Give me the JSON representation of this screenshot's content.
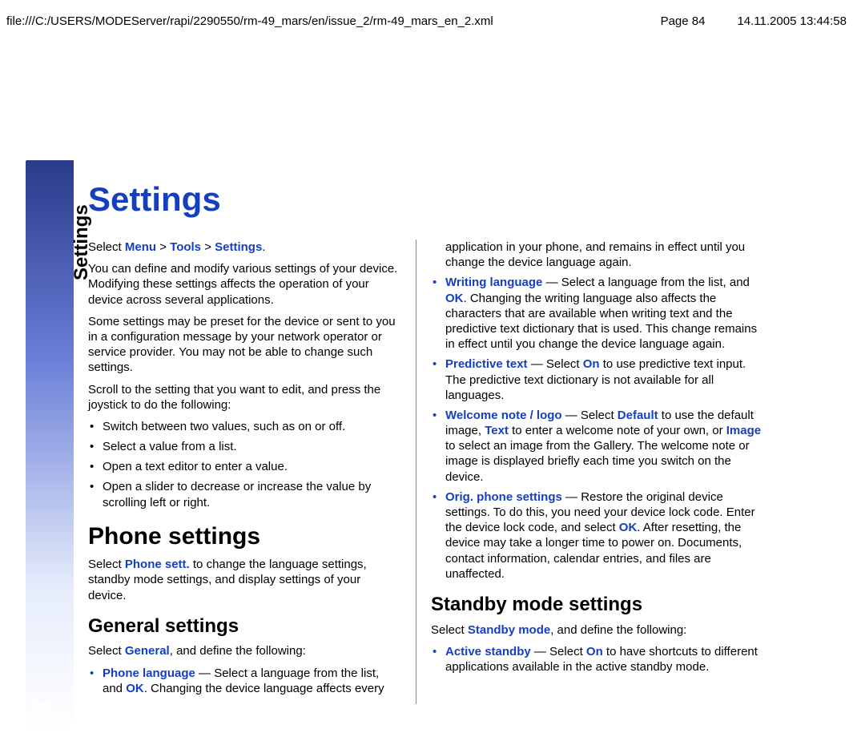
{
  "header": {
    "path": "file:///C:/USERS/MODEServer/rapi/2290550/rm-49_mars/en/issue_2/rm-49_mars_en_2.xml",
    "page": "Page 84",
    "datetime": "14.11.2005 13:44:58"
  },
  "side": {
    "label": "Settings",
    "page_number": "84"
  },
  "title": "Settings",
  "intro": {
    "breadcrumb_select": "Select ",
    "menu": "Menu",
    "gt1": " > ",
    "tools": "Tools",
    "gt2": " > ",
    "settings": "Settings",
    "dot": ".",
    "p2": "You can define and modify various settings of your device. Modifying these settings affects the operation of your device across several applications.",
    "p3": "Some settings may be preset for the device or sent to you in a configuration message by your network operator or service provider. You may not be able to change such settings.",
    "p4": "Scroll to the setting that you want to edit, and press the joystick to do the following:",
    "bullets": [
      "Switch between two values, such as on or off.",
      "Select a value from a list.",
      "Open a text editor to enter a value.",
      "Open a slider to decrease or increase the value by scrolling left or right."
    ]
  },
  "phone_settings": {
    "heading": "Phone settings",
    "p_pre": "Select ",
    "link": "Phone sett.",
    "p_post": " to change the language settings, standby mode settings, and display settings of your device."
  },
  "general": {
    "heading": "General settings",
    "p_pre": "Select ",
    "link": "General",
    "p_post": ", and define the following:",
    "items": {
      "phone_language": {
        "label": "Phone language",
        "dash": " — ",
        "t1": "Select a language from the list, and ",
        "ok": "OK",
        "t2": ". Changing the device language affects every application in your phone, and remains in effect until you change the device language again."
      },
      "writing_language": {
        "label": "Writing language",
        "dash": " — ",
        "t1": "Select a language from the list, and ",
        "ok": "OK",
        "t2": ". Changing the writing language also affects the characters that are available when writing text and the predictive text dictionary that is used. This change remains in effect until you change the device language again."
      },
      "predictive": {
        "label": "Predictive text",
        "dash": " — ",
        "t1": "Select ",
        "on": "On",
        "t2": " to use predictive text input. The predictive text dictionary is not available for all languages."
      },
      "welcome": {
        "label": "Welcome note / logo",
        "dash": " — ",
        "t1": "Select ",
        "default": "Default",
        "t2": " to use the default image, ",
        "text": "Text",
        "t3": " to enter a welcome note of your own, or ",
        "image": "Image",
        "t4": " to select an image from the Gallery. The welcome note or image is displayed briefly each time you switch on the device."
      },
      "orig": {
        "label": "Orig. phone settings",
        "dash": " — ",
        "t1": "Restore the original device settings. To do this, you need your device lock code. Enter the device lock code, and select ",
        "ok": "OK",
        "t2": ". After resetting, the device may take a longer time to power on. Documents, contact information, calendar entries, and files are unaffected."
      }
    }
  },
  "standby": {
    "heading": "Standby mode settings",
    "p_pre": "Select ",
    "link": "Standby mode",
    "p_post": ", and define the following:",
    "items": {
      "active": {
        "label": "Active standby",
        "dash": " — ",
        "t1": "Select ",
        "on": "On",
        "t2": " to have shortcuts to different applications available in the active standby mode."
      }
    }
  }
}
